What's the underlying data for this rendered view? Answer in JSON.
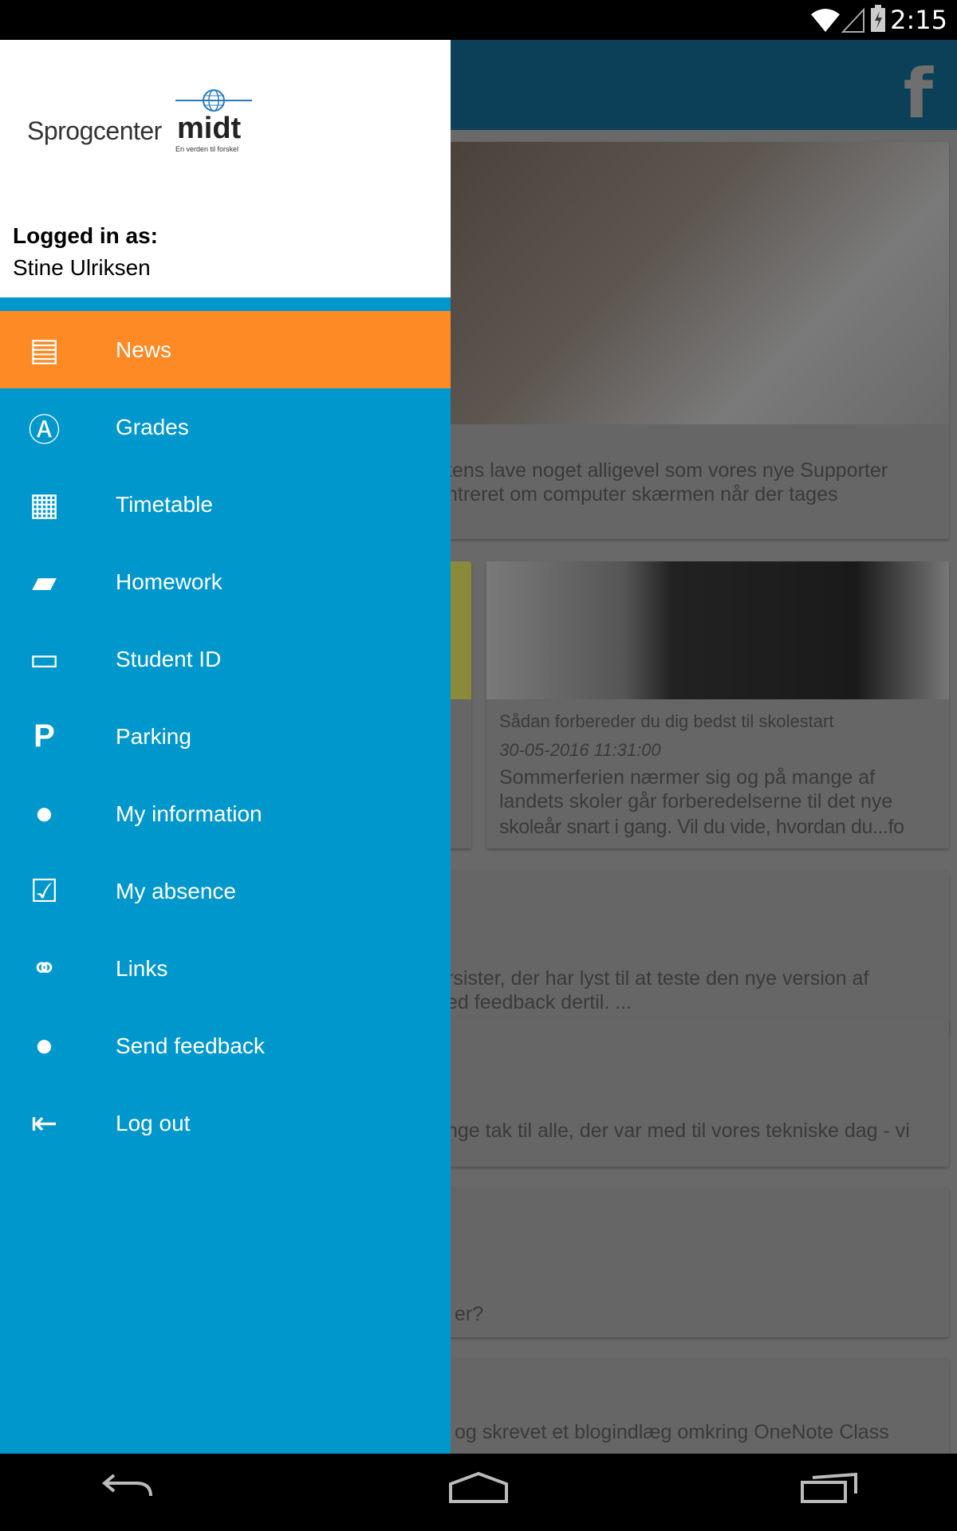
{
  "status_bar": {
    "time": "2:15",
    "icons": [
      "wifi-icon",
      "signal-icon",
      "battery-charging-icon"
    ]
  },
  "app_bar": {
    "facebook_label": "f"
  },
  "brand": {
    "logo_left": "Sprogcenter",
    "logo_right": "midt",
    "tagline": "En verden til forskel"
  },
  "user": {
    "logged_in_label": "Logged in as:",
    "name": "Stine Ulriksen"
  },
  "menu": {
    "items": [
      {
        "label": "News",
        "icon": "newspaper-icon",
        "active": true
      },
      {
        "label": "Grades",
        "icon": "grade-a-plus-icon"
      },
      {
        "label": "Timetable",
        "icon": "calendar-icon"
      },
      {
        "label": "Homework",
        "icon": "book-icon"
      },
      {
        "label": "Student ID",
        "icon": "id-card-icon"
      },
      {
        "label": "Parking",
        "icon": "parking-icon"
      },
      {
        "label": "My information",
        "icon": "user-icon"
      },
      {
        "label": "My absence",
        "icon": "checkbox-icon"
      },
      {
        "label": "Links",
        "icon": "link-icon"
      },
      {
        "label": "Send feedback",
        "icon": "chat-bubble-icon"
      },
      {
        "label": "Log out",
        "icon": "logout-icon"
      }
    ]
  },
  "news": {
    "card1": {
      "lines": [
        "tens lave noget alligevel som vores nye Supporter",
        "ntreret om computer skærmen når der tages"
      ]
    },
    "card2": {
      "title": "Sådan forbereder du dig bedst til skolestart",
      "date": "30-05-2016 11:31:00",
      "lines": [
        "Sommerferien nærmer sig og på mange af",
        "landets skoler går forberedelserne til det nye",
        "skoleår snart i gang. Vil du vide, hvordan du...fo"
      ]
    },
    "card3": {
      "lines": [
        "rsister, der har lyst til at teste den nye version af",
        "ed feedback dertil. ..."
      ]
    },
    "card4": {
      "lines": [
        "nge tak til alle, der var med til vores tekniske dag - vi"
      ]
    },
    "card5": {
      "lines": [
        "er?"
      ]
    },
    "card6": {
      "lines": [
        "og skrevet et blogindlæg omkring OneNote Class"
      ]
    }
  },
  "colors": {
    "drawer": "#0097cd",
    "active": "#fe8a25",
    "appbar": "#0b4058"
  }
}
